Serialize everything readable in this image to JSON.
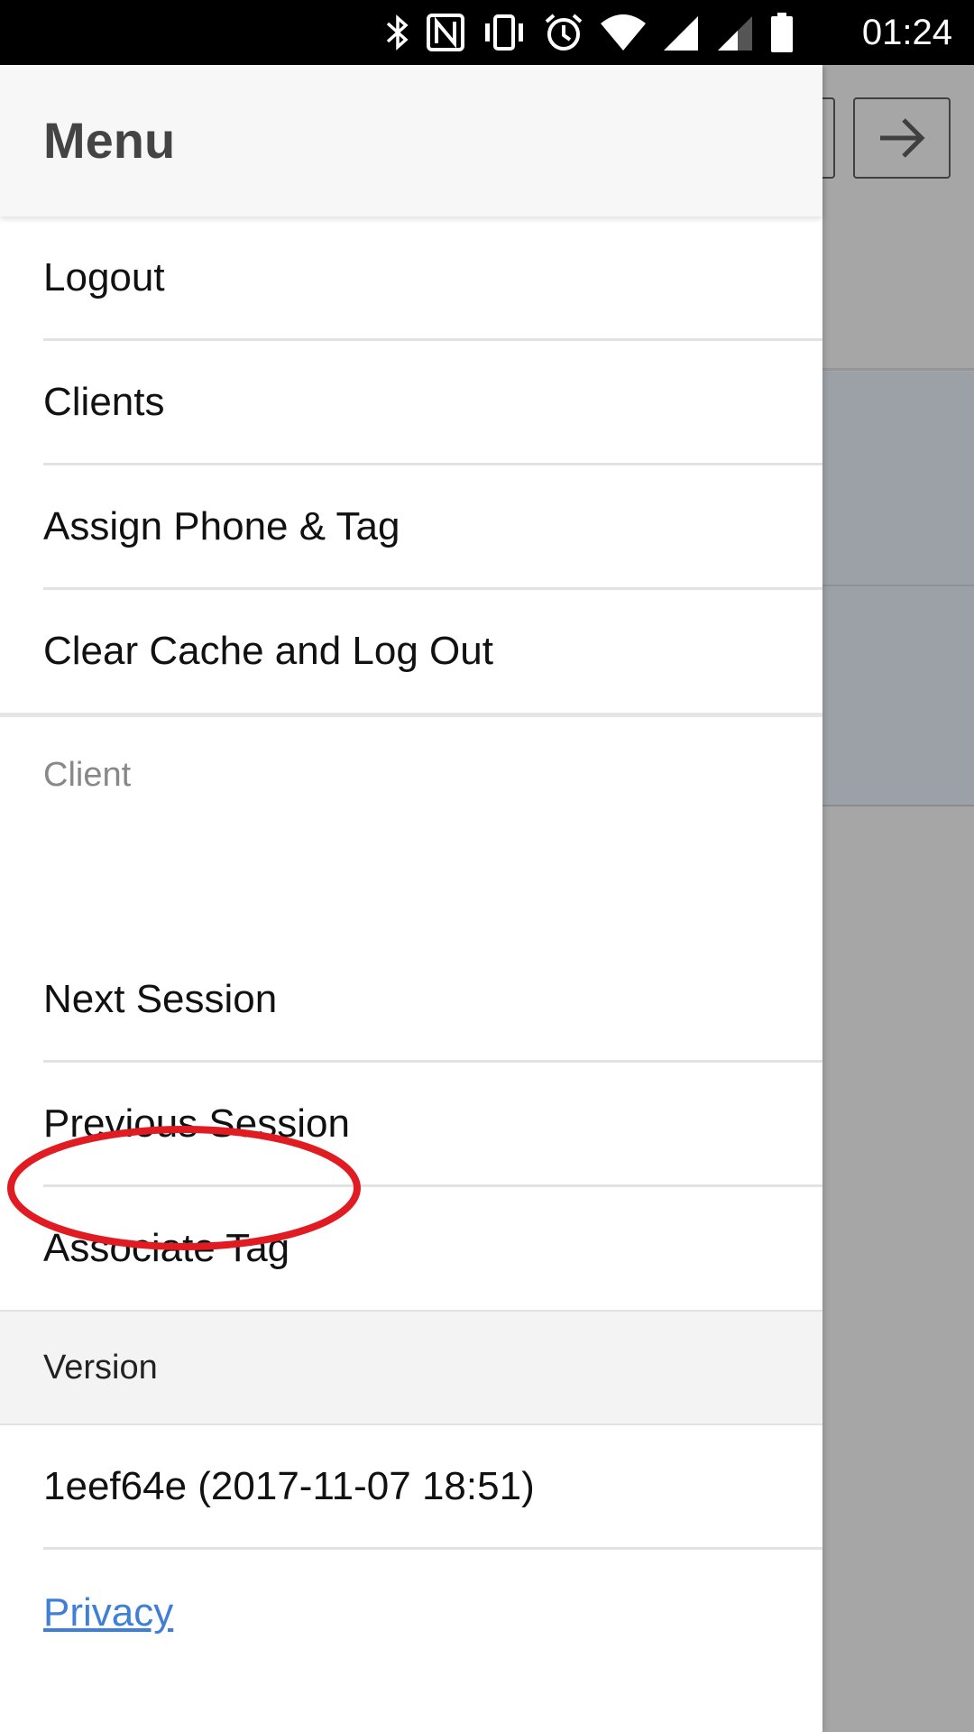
{
  "status_bar": {
    "time": "01:24",
    "icons": [
      "bluetooth-icon",
      "nfc-icon",
      "vibrate-icon",
      "alarm-icon",
      "wifi-icon",
      "cell-signal-icon",
      "cell-signal-2-icon",
      "battery-icon"
    ]
  },
  "background_app": {
    "header_buttons": [
      "previous-button",
      "next-arrow-button"
    ]
  },
  "drawer": {
    "title": "Menu",
    "main_items": [
      {
        "label": "Logout"
      },
      {
        "label": "Clients"
      },
      {
        "label": "Assign Phone & Tag"
      },
      {
        "label": "Clear Cache and Log Out"
      }
    ],
    "client_section": {
      "label": "Client",
      "items": [
        {
          "label": "Next Session"
        },
        {
          "label": "Previous Session"
        },
        {
          "label": "Associate Tag"
        }
      ]
    },
    "version_section": {
      "label": "Version",
      "value": "1eef64e (2017-11-07 18:51)"
    },
    "privacy_link": "Privacy"
  },
  "annotation": {
    "target": "Associate Tag",
    "color": "#e01b22"
  }
}
